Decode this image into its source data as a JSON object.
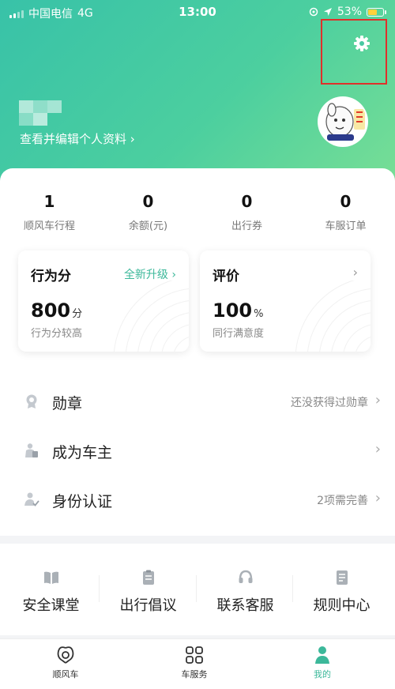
{
  "status_bar": {
    "carrier": "中国电信",
    "network": "4G",
    "time": "13:00",
    "battery": "53%",
    "battery_level": 0.53
  },
  "profile": {
    "edit_link": "查看并编辑个人资料 ›"
  },
  "stats": [
    {
      "value": "1",
      "label": "顺风车行程"
    },
    {
      "value": "0",
      "label": "余额(元)"
    },
    {
      "value": "0",
      "label": "出行券"
    },
    {
      "value": "0",
      "label": "车服订单"
    }
  ],
  "score_card": {
    "title": "行为分",
    "link": "全新升级 ›",
    "value": "800",
    "unit": "分",
    "desc": "行为分较高"
  },
  "rating_card": {
    "title": "评价",
    "chevron": "›",
    "value": "100",
    "unit": "%",
    "desc": "同行满意度"
  },
  "menu": [
    {
      "title": "勋章",
      "sub": "还没获得过勋章",
      "icon": "medal-icon"
    },
    {
      "title": "成为车主",
      "sub": "",
      "icon": "driver-icon"
    },
    {
      "title": "身份认证",
      "sub": "2项需完善",
      "icon": "verified-user-icon"
    }
  ],
  "quick_actions": [
    {
      "label": "安全课堂",
      "icon": "book-icon"
    },
    {
      "label": "出行倡议",
      "icon": "clipboard-icon"
    },
    {
      "label": "联系客服",
      "icon": "headset-icon"
    },
    {
      "label": "规则中心",
      "icon": "document-icon"
    }
  ],
  "tabs": [
    {
      "label": "顺风车",
      "icon": "rideshare-icon"
    },
    {
      "label": "车服务",
      "icon": "grid-icon"
    },
    {
      "label": "我的",
      "icon": "person-icon",
      "active": true
    }
  ],
  "colors": {
    "accent": "#3cb89a",
    "header_start": "#38c2a8",
    "header_end": "#7adf95",
    "highlight": "#e0302a"
  }
}
